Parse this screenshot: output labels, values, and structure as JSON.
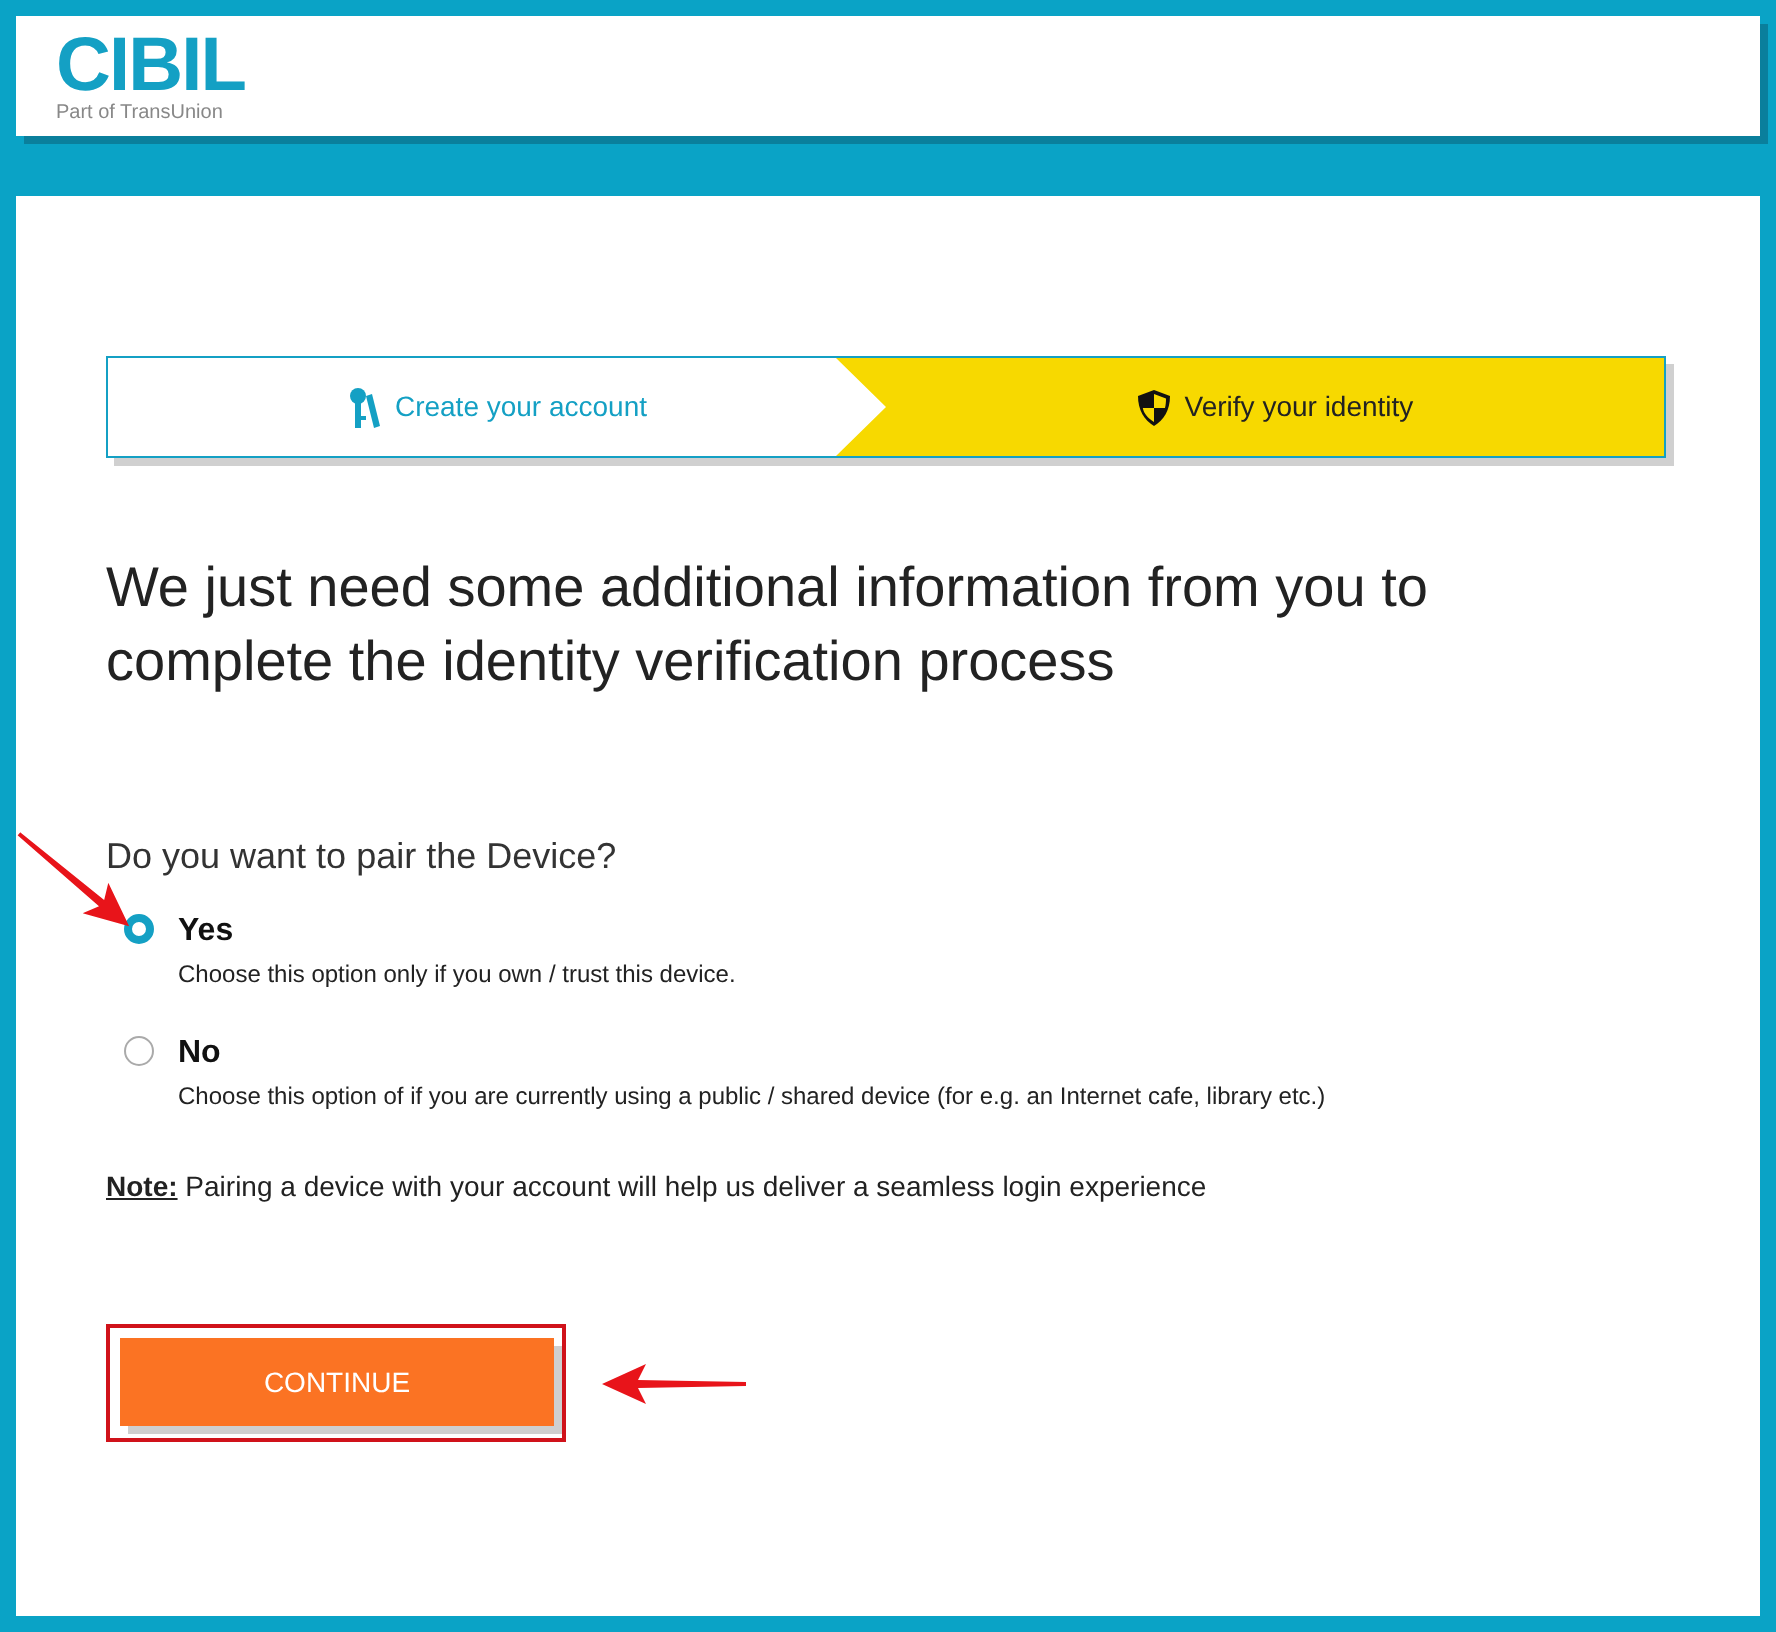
{
  "header": {
    "logo": "CIBIL",
    "tagline": "Part of TransUnion"
  },
  "steps": [
    {
      "label": "Create your account",
      "kind": "keys",
      "selected": false
    },
    {
      "label": "Verify your identity",
      "kind": "shield",
      "selected": true
    }
  ],
  "heading": "We just need some additional information from you to complete the identity verification process",
  "question": "Do you want to pair the Device?",
  "options": [
    {
      "label": "Yes",
      "description": "Choose this option only if you own / trust this device.",
      "selected": true
    },
    {
      "label": "No",
      "description": "Choose this option of if you are currently using a public / shared device (for e.g. an Internet cafe, library etc.)",
      "selected": false
    }
  ],
  "note": "**Note:** Pairing a device with your account will help us deliver a seamless login experience",
  "button": "CONTINUE"
}
